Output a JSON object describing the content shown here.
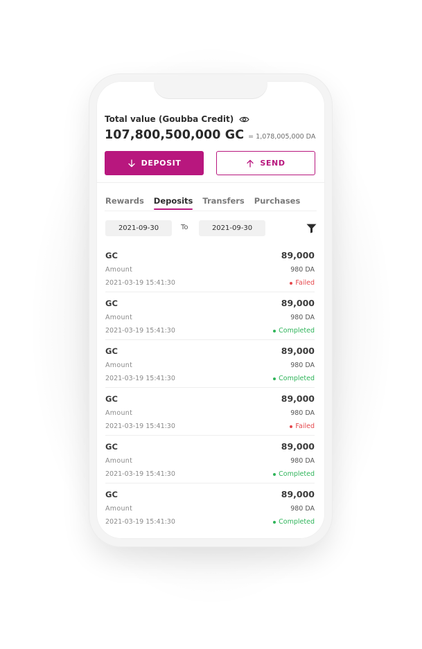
{
  "colors": {
    "accent": "#b8177e",
    "failed": "#e5484d",
    "completed": "#2fb45a"
  },
  "header": {
    "total_label": "Total value (Goubba Credit)",
    "eye_icon": "eye-icon",
    "total_value": "107,800,500,000 GC",
    "total_da": "= 1,078,005,000 DA"
  },
  "actions": {
    "deposit_label": "DEPOSIT",
    "deposit_icon": "arrow-down-icon",
    "send_label": "SEND",
    "send_icon": "arrow-up-icon"
  },
  "tabs": [
    {
      "label": "Rewards",
      "active": false
    },
    {
      "label": "Deposits",
      "active": true
    },
    {
      "label": "Transfers",
      "active": false
    },
    {
      "label": "Purchases",
      "active": false
    }
  ],
  "filter": {
    "from": "2021-09-30",
    "to_label": "To",
    "to": "2021-09-30",
    "icon": "filter-icon"
  },
  "transactions": [
    {
      "currency": "GC",
      "amount_label": "Amount",
      "datetime": "2021-03-19  15:41:30",
      "value": "89,000",
      "da": "980 DA",
      "status": "Failed"
    },
    {
      "currency": "GC",
      "amount_label": "Amount",
      "datetime": "2021-03-19  15:41:30",
      "value": "89,000",
      "da": "980 DA",
      "status": "Completed"
    },
    {
      "currency": "GC",
      "amount_label": "Amount",
      "datetime": "2021-03-19  15:41:30",
      "value": "89,000",
      "da": "980 DA",
      "status": "Completed"
    },
    {
      "currency": "GC",
      "amount_label": "Amount",
      "datetime": "2021-03-19  15:41:30",
      "value": "89,000",
      "da": "980 DA",
      "status": "Failed"
    },
    {
      "currency": "GC",
      "amount_label": "Amount",
      "datetime": "2021-03-19  15:41:30",
      "value": "89,000",
      "da": "980 DA",
      "status": "Completed"
    },
    {
      "currency": "GC",
      "amount_label": "Amount",
      "datetime": "2021-03-19  15:41:30",
      "value": "89,000",
      "da": "980 DA",
      "status": "Completed"
    }
  ]
}
